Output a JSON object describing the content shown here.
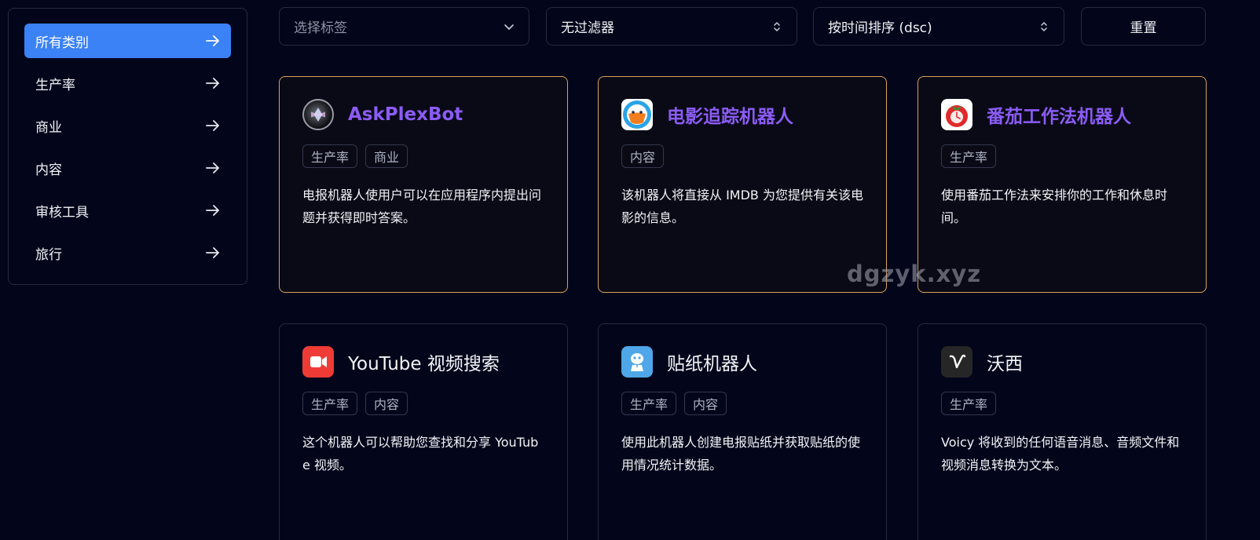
{
  "sidebar": {
    "items": [
      {
        "label": "所有类别",
        "active": true
      },
      {
        "label": "生产率"
      },
      {
        "label": "商业"
      },
      {
        "label": "内容"
      },
      {
        "label": "审核工具"
      },
      {
        "label": "旅行"
      }
    ]
  },
  "toolbar": {
    "tag_select_placeholder": "选择标签",
    "filter_value": "无过滤器",
    "sort_value": "按时间排序 (dsc)",
    "reset_label": "重置"
  },
  "cards": [
    {
      "title": "AskPlexBot",
      "tags": [
        "生产率",
        "商业"
      ],
      "description": "电报机器人使用户可以在应用程序内提出问题并获得即时答案。",
      "avatar_icon": "plex-logo-icon"
    },
    {
      "title": "电影追踪机器人",
      "tags": [
        "内容"
      ],
      "description": "该机器人将直接从 IMDB 为您提供有关该电影的信息。",
      "avatar_icon": "movie-bot-icon"
    },
    {
      "title": "番茄工作法机器人",
      "tags": [
        "生产率"
      ],
      "description": "使用番茄工作法来安排你的工作和休息时间。",
      "avatar_icon": "tomato-timer-icon"
    },
    {
      "title": "YouTube 视频搜索",
      "tags": [
        "生产率",
        "内容"
      ],
      "description": "这个机器人可以帮助您查找和分享 YouTube 视频。",
      "avatar_icon": "video-camera-icon"
    },
    {
      "title": "贴纸机器人",
      "tags": [
        "生产率",
        "内容"
      ],
      "description": "使用此机器人创建电报贴纸并获取贴纸的使用情况统计数据。",
      "avatar_icon": "sticker-robot-icon"
    },
    {
      "title": "沃西",
      "tags": [
        "生产率"
      ],
      "description": "Voicy 将收到的任何语音消息、音频文件和视频消息转换为文本。",
      "avatar_icon": "voicy-logo-icon"
    }
  ],
  "watermark": "dgzyk.xyz",
  "colors": {
    "background": "#03061a",
    "accent": "#3b82f6",
    "featured_border": "#d9a05b",
    "featured_title": "#8b5cf6"
  }
}
